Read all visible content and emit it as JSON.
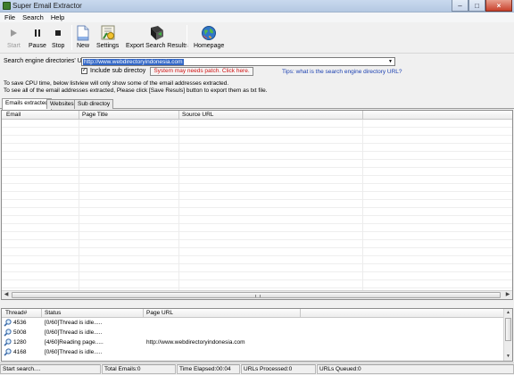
{
  "window": {
    "title": "Super Email Extractor"
  },
  "menu": [
    "File",
    "Search",
    "Help"
  ],
  "toolbar": {
    "start": "Start",
    "pause": "Pause",
    "stop": "Stop",
    "new": "New",
    "settings": "Settings",
    "export": "Export Search Results",
    "homepage": "Homepage"
  },
  "form": {
    "url_label": "Search engine directories' URL:",
    "url_value": "http://www.webdirectoryindonesia.com",
    "include_sub_label": "Include sub directoy",
    "include_sub_checked": true,
    "patch_button": "System may needs patch. Click here.",
    "tips_link": "Tips: what is the search engine directory URL?",
    "info_line1": "To save CPU time, below listview will only show some of the email addresses extracted.",
    "info_line2": "To see all of the email addresses extracted, Please click [Save Resuls] button to export them as txt file."
  },
  "tabs": [
    "Emails extracted",
    "Websites",
    "Sub directoy"
  ],
  "active_tab": 0,
  "results_table": {
    "columns": [
      "Email",
      "Page Title",
      "Source URL"
    ],
    "rows": []
  },
  "threads_table": {
    "columns": [
      "Thread#",
      "Status",
      "Page URL"
    ],
    "rows": [
      {
        "id": "4536",
        "status": "[0/60]Thread is idle.....",
        "url": ""
      },
      {
        "id": "5008",
        "status": "[0/60]Thread is idle.....",
        "url": ""
      },
      {
        "id": "1280",
        "status": "[4/60]Reading page.....",
        "url": "http://www.webdirectoryindonesia.com"
      },
      {
        "id": "4168",
        "status": "[0/60]Thread is idle.....",
        "url": ""
      }
    ]
  },
  "status": {
    "state": "Start search....",
    "total_emails": "Total Emails:0",
    "elapsed": "Time Elapsed:00:04",
    "processed": "URLs Processed:0",
    "queued": "URLs Queued:0"
  },
  "colors": {
    "link": "#1a3fb0",
    "warning": "#d01010",
    "selection": "#3267c7"
  },
  "icons": [
    "app-icon",
    "play-icon",
    "pause-icon",
    "stop-icon",
    "new-document-icon",
    "settings-icon",
    "export-icon",
    "homepage-icon",
    "magnifier-icon"
  ]
}
